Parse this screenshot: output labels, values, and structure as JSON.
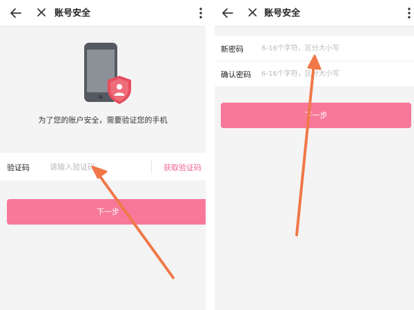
{
  "left": {
    "header": {
      "title": "账号安全"
    },
    "message": "为了您的账户安全，需要验证您的手机",
    "code_row": {
      "label": "验证码",
      "placeholder": "请输入验证码",
      "get_code": "获取验证码"
    },
    "next_button": "下一步"
  },
  "right": {
    "header": {
      "title": "账号安全"
    },
    "fields": [
      {
        "label": "新密码",
        "placeholder": "6-16个字符，区分大小写"
      },
      {
        "label": "确认密码",
        "placeholder": "6-16个字符，区分大小写"
      }
    ],
    "next_button": "下一步"
  },
  "colors": {
    "accent": "#f77898",
    "link": "#f0658f",
    "annotation_arrow": "#f07848",
    "shield": "#e64d5f"
  },
  "icons": [
    "back-arrow-icon",
    "close-icon",
    "more-vertical-icon",
    "phone-shield-icon"
  ]
}
